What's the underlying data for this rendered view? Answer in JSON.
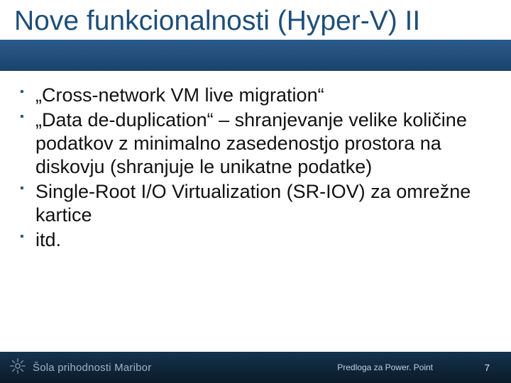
{
  "slide": {
    "title": "Nove funkcionalnosti (Hyper-V) II",
    "bullets": [
      "„Cross-network VM live migration“",
      "„Data de-duplication“ – shranjevanje velike količine podatkov z minimalno zasedenostjo prostora na diskovju (shranjuje le unikatne podatke)",
      "Single-Root I/O Virtualization (SR-IOV) za omrežne kartice",
      "itd."
    ]
  },
  "footer": {
    "brand": "Šola prihodnosti Maribor",
    "template_label": "Predloga za Power. Point",
    "page_number": "7"
  }
}
